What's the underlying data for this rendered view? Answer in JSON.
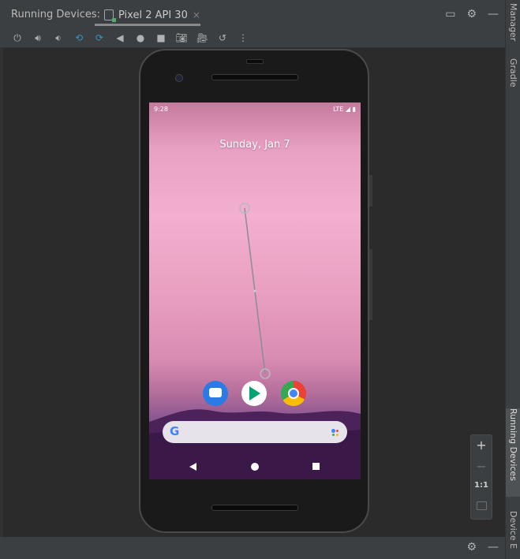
{
  "header": {
    "title": "Running Devices:",
    "tab_label": "Pixel 2 API 30",
    "tab_close": "×"
  },
  "toolbar": {
    "icons": [
      "power-icon",
      "volume-up-icon",
      "volume-down-icon",
      "rotate-left-icon",
      "rotate-right-icon",
      "back-icon",
      "home-icon",
      "overview-icon",
      "screenshot-icon",
      "screen-record-icon",
      "snapshot-icon",
      "more-icon"
    ]
  },
  "right_strip": {
    "tabs": {
      "manager": "Manager",
      "gradle": "Gradle",
      "running": "Running Devices",
      "explorer": "Device E"
    }
  },
  "device": {
    "status_time": "9:28",
    "status_icons": "LTE ◢ ▮",
    "date": "Sunday, Jan 7",
    "apps": [
      "Messages",
      "Play Store",
      "Chrome"
    ],
    "search_logo": "G"
  },
  "zoom": {
    "plus": "+",
    "minus": "−",
    "actual_size": "1:1"
  },
  "colors": {
    "accent": "#3592c4",
    "panel": "#3c3f41",
    "background": "#2b2b2b"
  }
}
